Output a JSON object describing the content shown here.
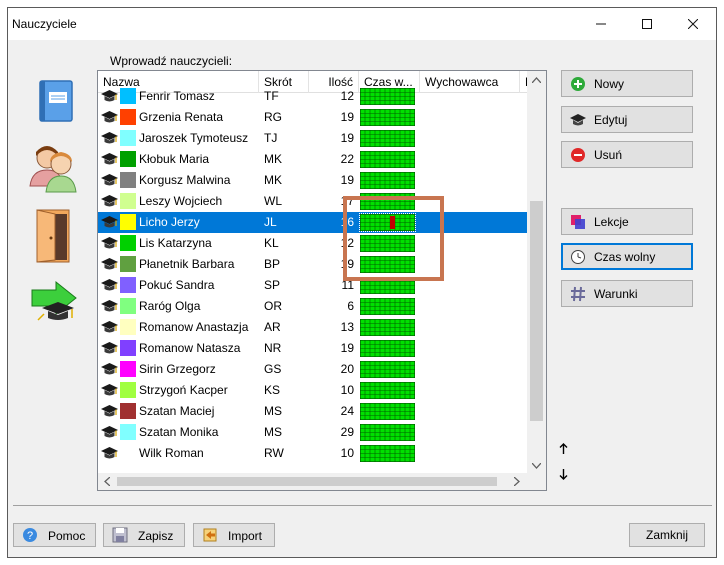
{
  "window": {
    "title": "Nauczyciele"
  },
  "section_label": "Wprowadź nauczycieli:",
  "columns": [
    "Nazwa",
    "Skrót",
    "Ilość",
    "Czas w...",
    "Wychowawca",
    "F"
  ],
  "teachers": [
    {
      "name": "Fenrir Tomasz",
      "code": "TF",
      "count": "12",
      "color": "#00bfff",
      "partial": true
    },
    {
      "name": "Grzenia Renata",
      "code": "RG",
      "count": "19",
      "color": "#ff4000"
    },
    {
      "name": "Jaroszek Tymoteusz",
      "code": "TJ",
      "count": "19",
      "color": "#80ffff"
    },
    {
      "name": "Kłobuk Maria",
      "code": "MK",
      "count": "22",
      "color": "#00a000"
    },
    {
      "name": "Korgusz Malwina",
      "code": "MK",
      "count": "19",
      "color": "#808080"
    },
    {
      "name": "Leszy Wojciech",
      "code": "WL",
      "count": "17",
      "color": "#d0ff90"
    },
    {
      "name": "Licho Jerzy",
      "code": "JL",
      "count": "16",
      "color": "#ffff00",
      "selected": true,
      "marker": true
    },
    {
      "name": "Lis Katarzyna",
      "code": "KL",
      "count": "12",
      "color": "#00d000"
    },
    {
      "name": "Płanetnik Barbara",
      "code": "BP",
      "count": "19",
      "color": "#60a040"
    },
    {
      "name": "Pokuć Sandra",
      "code": "SP",
      "count": "11",
      "color": "#8060ff"
    },
    {
      "name": "Raróg Olga",
      "code": "OR",
      "count": "6",
      "color": "#80ff80"
    },
    {
      "name": "Romanow Anastazja",
      "code": "AR",
      "count": "13",
      "color": "#ffffc0"
    },
    {
      "name": "Romanow Natasza",
      "code": "NR",
      "count": "19",
      "color": "#8040ff"
    },
    {
      "name": "Sirin Grzegorz",
      "code": "GS",
      "count": "20",
      "color": "#ff00ff"
    },
    {
      "name": "Strzygoń Kacper",
      "code": "KS",
      "count": "10",
      "color": "#a0ff40"
    },
    {
      "name": "Szatan Maciej",
      "code": "MS",
      "count": "24",
      "color": "#a03030"
    },
    {
      "name": "Szatan Monika",
      "code": "MS",
      "count": "29",
      "color": "#80ffff"
    },
    {
      "name": "Wilk Roman",
      "code": "RW",
      "count": "10",
      "color": "#ffffff"
    }
  ],
  "buttons": {
    "new": "Nowy",
    "edit": "Edytuj",
    "delete": "Usuń",
    "lessons": "Lekcje",
    "free_time": "Czas wolny",
    "conditions": "Warunki",
    "help": "Pomoc",
    "save": "Zapisz",
    "import": "Import",
    "close": "Zamknij"
  },
  "colors": {
    "accent": "#0078d7",
    "free_time_green": "#00e000",
    "blocked_red": "#c00000",
    "highlight": "#c87550"
  },
  "icons": {
    "sidebar": [
      "book-icon",
      "people-icon",
      "door-icon",
      "arrow-export-icon"
    ],
    "row": "graduation-cap-icon"
  }
}
